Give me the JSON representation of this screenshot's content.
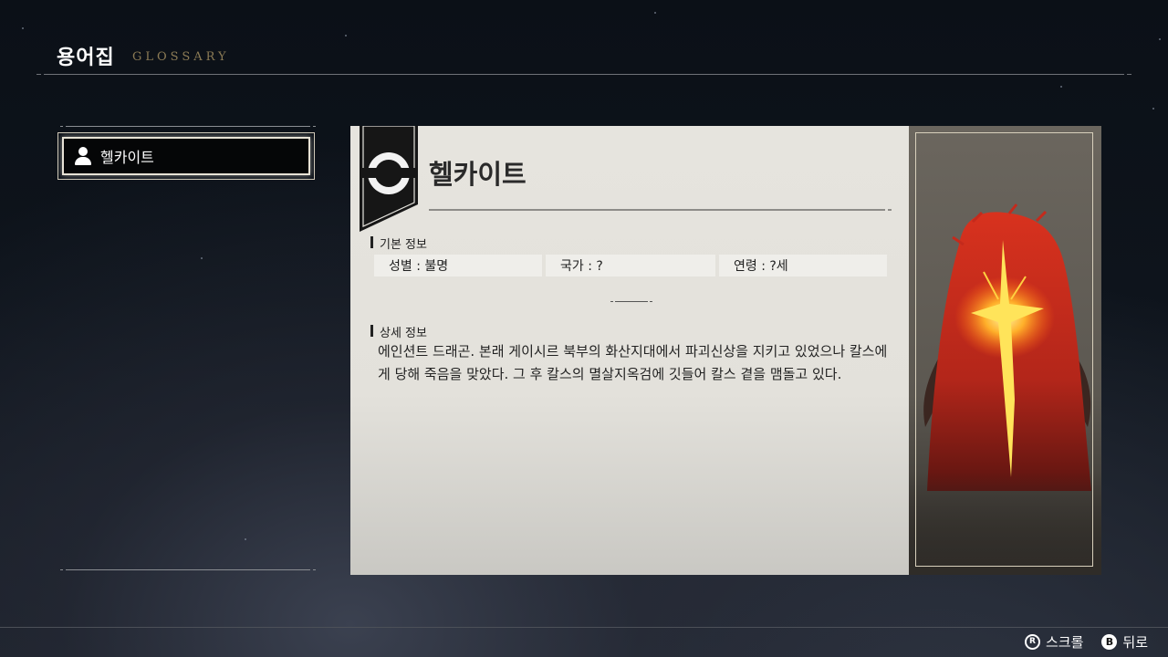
{
  "header": {
    "title": "용어집",
    "subtitle": "GLOSSARY"
  },
  "list": {
    "items": [
      {
        "label": "헬카이트",
        "icon": "person-icon",
        "selected": true
      }
    ]
  },
  "entry": {
    "name": "헬카이트",
    "basic_info_title": "기본 정보",
    "gender": "성별 : 불명",
    "country": "국가 : ?",
    "age": "연령 : ?세",
    "detail_title": "상세 정보",
    "description": "에인션트 드래곤. 본래 게이시르 북부의 화산지대에서 파괴신상을 지키고 있었으나 칼스에게 당해 죽음을 맞았다. 그 후 칼스의 멸살지옥검에 깃들어 칼스 곁을 맴돌고 있다."
  },
  "footer": {
    "scroll_button": "R",
    "scroll_label": "스크롤",
    "back_button": "B",
    "back_label": "뒤로"
  },
  "colors": {
    "accent_gold": "#8c7b55",
    "panel_bg": "#e6e4de",
    "portrait_red": "#c8281e"
  }
}
